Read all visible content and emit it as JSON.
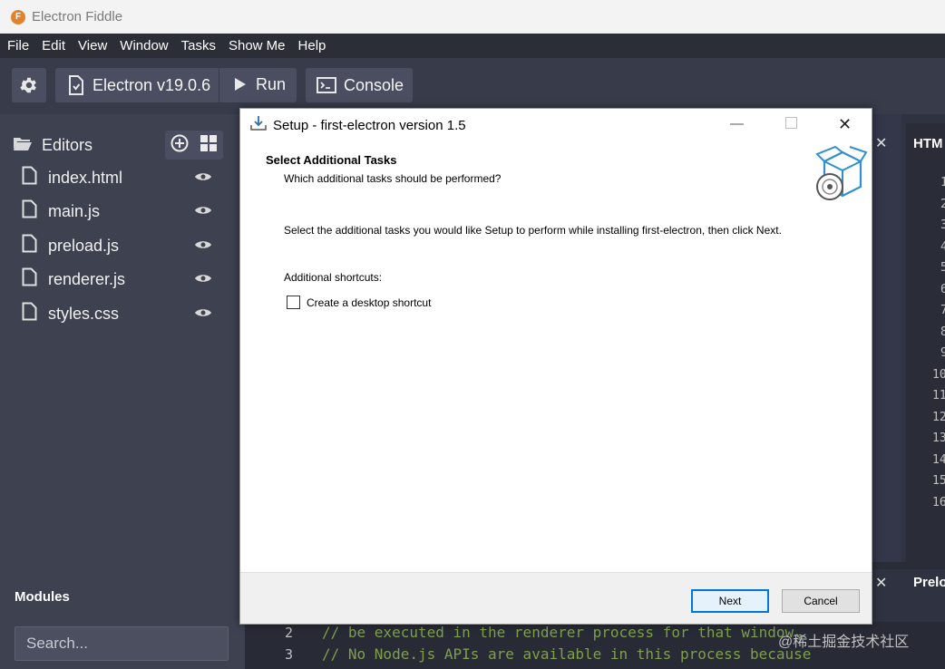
{
  "app": {
    "title": "Electron Fiddle",
    "logo_letter": "F"
  },
  "menu": [
    "File",
    "Edit",
    "View",
    "Window",
    "Tasks",
    "Show Me",
    "Help"
  ],
  "toolbar": {
    "version_label": "Electron v19.0.6",
    "run_label": "Run",
    "console_label": "Console"
  },
  "sidebar": {
    "editors_label": "Editors",
    "files": [
      "index.html",
      "main.js",
      "preload.js",
      "renderer.js",
      "styles.css"
    ],
    "modules_label": "Modules",
    "search_placeholder": "Search..."
  },
  "panels": {
    "top_title": "HTM",
    "bottom_title": "Prelo"
  },
  "gutter_top": [
    "1",
    "2",
    "3",
    "4",
    "5",
    "6",
    "7",
    "8",
    "9",
    "10",
    "11",
    "12",
    "13",
    "14",
    "15",
    "16"
  ],
  "code": {
    "lines": [
      {
        "num": "2",
        "text": "// be executed in the renderer process for that window."
      },
      {
        "num": "3",
        "text": "// No Node.js APIs are available in this process because"
      }
    ]
  },
  "dialog": {
    "title": "Setup - first-electron version 1.5",
    "header_title": "Select Additional Tasks",
    "header_subtitle": "Which additional tasks should be performed?",
    "body_text": "Select the additional tasks you would like Setup to perform while installing first-electron, then click Next.",
    "shortcuts_label": "Additional shortcuts:",
    "checkbox_label": "Create a desktop shortcut",
    "next_label": "Next",
    "cancel_label": "Cancel"
  },
  "watermark": "@稀土掘金技术社区",
  "colors": {
    "accent": "#0078d7",
    "sidebar": "#3d4150",
    "toolbar": "#383b4a"
  }
}
